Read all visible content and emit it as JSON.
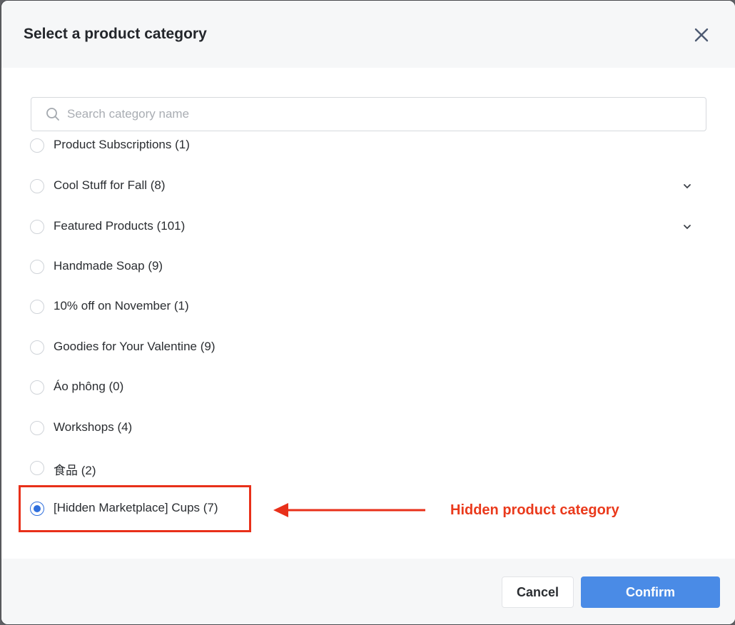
{
  "modal": {
    "title": "Select a product category",
    "close_icon": "close-icon"
  },
  "search": {
    "placeholder": "Search category name",
    "value": "",
    "icon": "search-icon"
  },
  "categories": [
    {
      "label": "Product Subscriptions (1)",
      "checked": false,
      "expandable": false
    },
    {
      "label": "Cool Stuff for Fall (8)",
      "checked": false,
      "expandable": true
    },
    {
      "label": "Featured Products (101)",
      "checked": false,
      "expandable": true
    },
    {
      "label": "Handmade Soap (9)",
      "checked": false,
      "expandable": false
    },
    {
      "label": "10% off on November (1)",
      "checked": false,
      "expandable": false
    },
    {
      "label": "Goodies for Your Valentine (9)",
      "checked": false,
      "expandable": false
    },
    {
      "label": "Áo phông (0)",
      "checked": false,
      "expandable": false
    },
    {
      "label": "Workshops (4)",
      "checked": false,
      "expandable": false
    },
    {
      "label": "食品 (2)",
      "checked": false,
      "expandable": false
    },
    {
      "label": "[Hidden Marketplace] Cups (7)",
      "checked": true,
      "expandable": false
    }
  ],
  "annotation": {
    "text": "Hidden product category",
    "color": "#ea3a1c"
  },
  "footer": {
    "cancel_label": "Cancel",
    "confirm_label": "Confirm"
  },
  "colors": {
    "accent": "#4a8be6",
    "radio_checked": "#2f6fdd"
  }
}
